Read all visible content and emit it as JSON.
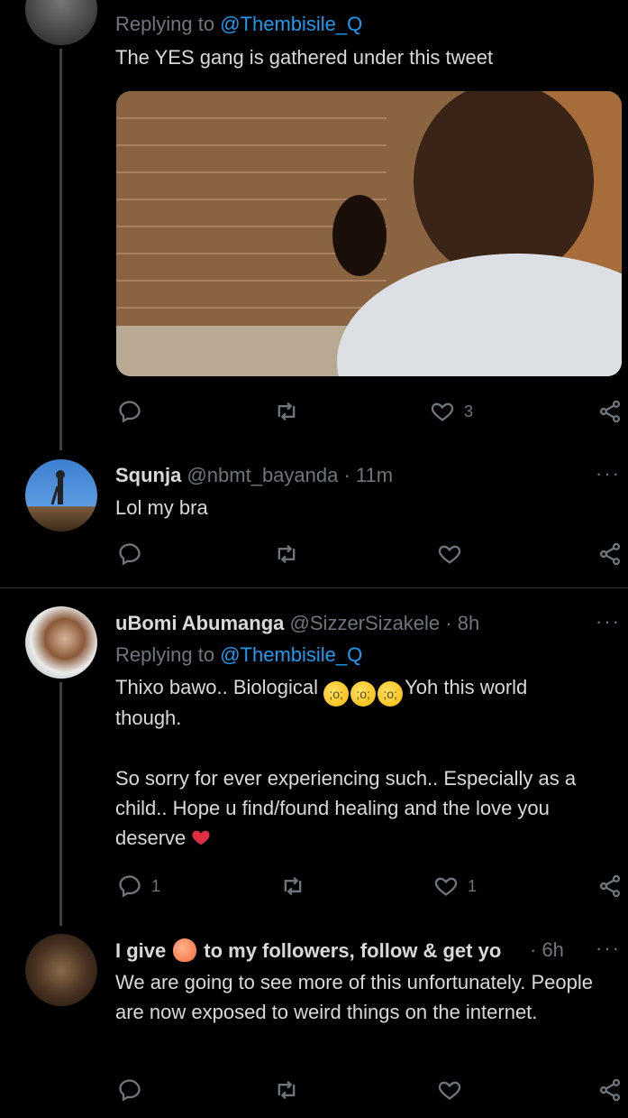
{
  "tweets": [
    {
      "replying_label": "Replying to",
      "replying_handle": "@Thembisile_Q",
      "text": "The YES gang is gathered under this tweet",
      "actions": {
        "replies": "",
        "retweets": "",
        "likes": "3"
      }
    },
    {
      "name": "Squnja",
      "handle": "@nbmt_bayanda",
      "time": "· 11m",
      "text": "Lol my bra",
      "actions": {
        "replies": "",
        "retweets": "",
        "likes": ""
      }
    },
    {
      "name": "uBomi Abumanga",
      "handle": "@SizzerSizakele",
      "time": "· 8h",
      "replying_label": "Replying to",
      "replying_handle": "@Thembisile_Q",
      "text_line1_a": "Thixo bawo.. Biological ",
      "text_line1_b": "Yoh this world",
      "text_line2": "though.",
      "text_para2": "So sorry for ever experiencing such.. Especially as a child.. Hope u find/found healing and the love you deserve",
      "actions": {
        "replies": "1",
        "retweets": "",
        "likes": "1"
      }
    },
    {
      "name_a": "I give",
      "name_b": "to my followers, follow & get yo",
      "time": "· 6h",
      "text": "We are going to see more of this unfortunately. People are now exposed to weird things on the internet.",
      "actions": {
        "replies": "",
        "retweets": "",
        "likes": ""
      }
    }
  ],
  "icons": {
    "reply": "speech-bubble-icon",
    "retweet": "retweet-icon",
    "like": "heart-icon",
    "share": "share-icon",
    "more": "more-icon"
  },
  "colors": {
    "background": "#000000",
    "link": "#1d9bf0",
    "muted": "#6e767d",
    "text": "#d9d9d9"
  }
}
